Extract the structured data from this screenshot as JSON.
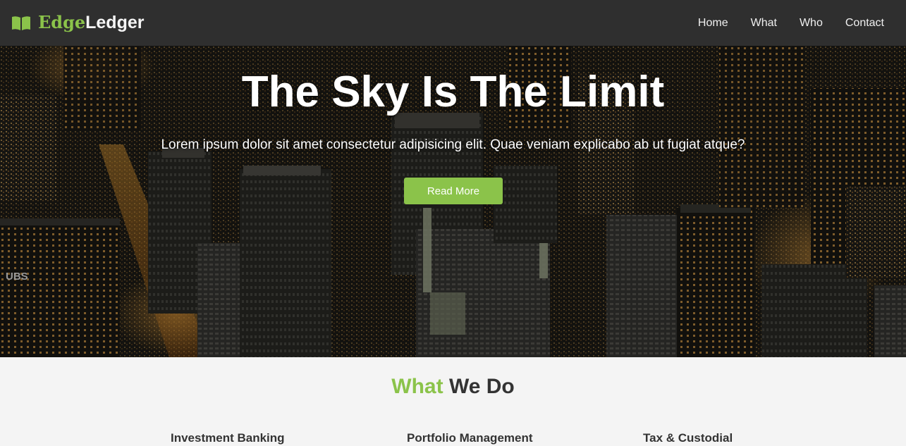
{
  "brand": {
    "part1": "Edge",
    "part2": "Ledger",
    "icon": "open-book-icon",
    "accent_color": "#8bc34a"
  },
  "nav": {
    "items": [
      "Home",
      "What",
      "Who",
      "Contact"
    ]
  },
  "hero": {
    "title": "The Sky Is The Limit",
    "subtitle": "Lorem ipsum dolor sit amet consectetur adipisicing elit. Quae veniam explicabo ab ut fugiat atque?",
    "button": "Read More",
    "background_image": "night-city-skyline-aerial",
    "sign_text": "UBS"
  },
  "what_we_do": {
    "title_accent": "What",
    "title_rest": "We Do",
    "services": [
      "Investment Banking",
      "Portfolio Management",
      "Tax & Custodial"
    ]
  },
  "colors": {
    "accent": "#8bc34a",
    "navbar": "#2f2f2f",
    "section_bg": "#f4f4f4",
    "heading": "#333333"
  }
}
